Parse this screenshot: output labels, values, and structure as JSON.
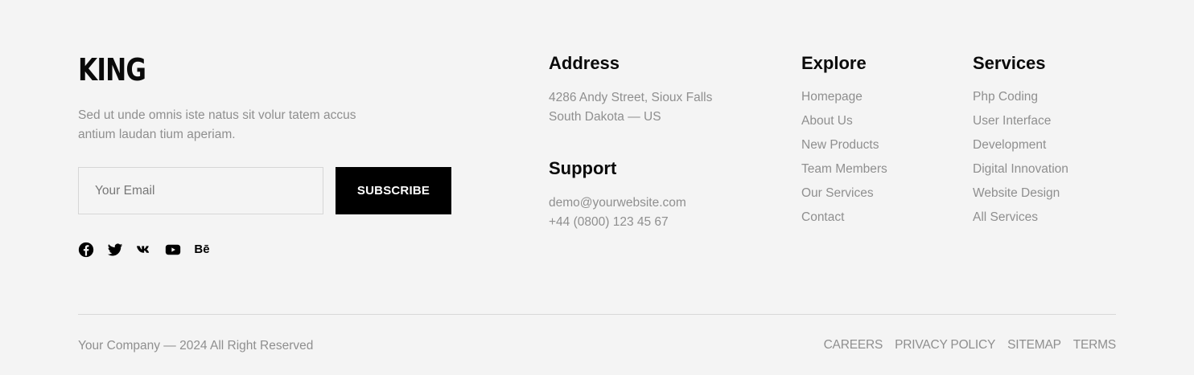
{
  "brand": {
    "logo": "KING",
    "description": "Sed ut unde omnis iste natus sit volur tatem accus antium laudan tium aperiam."
  },
  "newsletter": {
    "email_placeholder": "Your Email",
    "email_value": "",
    "subscribe_label": "SUBSCRIBE"
  },
  "socials": [
    {
      "icon": "facebook-icon"
    },
    {
      "icon": "twitter-icon"
    },
    {
      "icon": "vk-icon"
    },
    {
      "icon": "youtube-icon"
    },
    {
      "icon": "behance-icon",
      "text": "Bē"
    }
  ],
  "address": {
    "title": "Address",
    "line1": "4286 Andy Street, Sioux Falls",
    "line2": "South Dakota — US"
  },
  "support": {
    "title": "Support",
    "email": "demo@yourwebsite.com",
    "phone": "+44 (0800) 123 45 67"
  },
  "explore": {
    "title": "Explore",
    "items": [
      "Homepage",
      "About Us",
      "New Products",
      "Team Members",
      "Our Services",
      "Contact"
    ]
  },
  "services": {
    "title": "Services",
    "items": [
      "Php Coding",
      "User Interface",
      "Development",
      "Digital Innovation",
      "Website Design",
      "All Services"
    ]
  },
  "bottom": {
    "copyright": "Your Company — 2024 All Right Reserved",
    "links": [
      "CAREERS",
      "PRIVACY POLICY",
      "SITEMAP",
      "TERMS"
    ]
  },
  "colors": {
    "background": "#f4f4f4",
    "text_muted": "#8f8f8f",
    "heading": "#0a0a0a",
    "button_bg": "#000000",
    "button_text": "#ffffff"
  }
}
